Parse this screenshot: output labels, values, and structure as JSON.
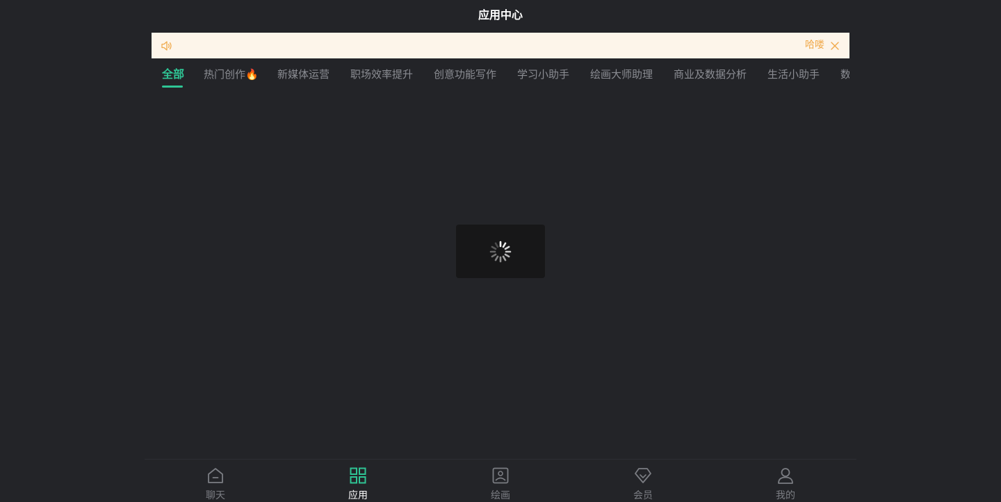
{
  "header": {
    "title": "应用中心"
  },
  "notice": {
    "icon": "speaker-icon",
    "text": "",
    "action_label": "哈喽",
    "close_icon": "close-icon",
    "color": "#f0a94b",
    "background": "#fdf5ea"
  },
  "tabs": [
    {
      "label": "全部",
      "active": true
    },
    {
      "label": "热门创作🔥",
      "active": false
    },
    {
      "label": "新媒体运营",
      "active": false
    },
    {
      "label": "职场效率提升",
      "active": false
    },
    {
      "label": "创意功能写作",
      "active": false
    },
    {
      "label": "学习小助手",
      "active": false
    },
    {
      "label": "绘画大师助理",
      "active": false
    },
    {
      "label": "商业及数据分析",
      "active": false
    },
    {
      "label": "生活小助手",
      "active": false
    },
    {
      "label": "数",
      "active": false
    }
  ],
  "loading": {
    "icon": "spinner-icon"
  },
  "bottom_nav": [
    {
      "label": "聊天",
      "icon": "home-icon",
      "active": false
    },
    {
      "label": "应用",
      "icon": "grid-icon",
      "active": true
    },
    {
      "label": "绘画",
      "icon": "image-icon",
      "active": false
    },
    {
      "label": "会员",
      "icon": "diamond-icon",
      "active": false
    },
    {
      "label": "我的",
      "icon": "user-icon",
      "active": false
    }
  ],
  "colors": {
    "background": "#232428",
    "accent": "#2fc595",
    "inactive": "#8b8d93"
  }
}
